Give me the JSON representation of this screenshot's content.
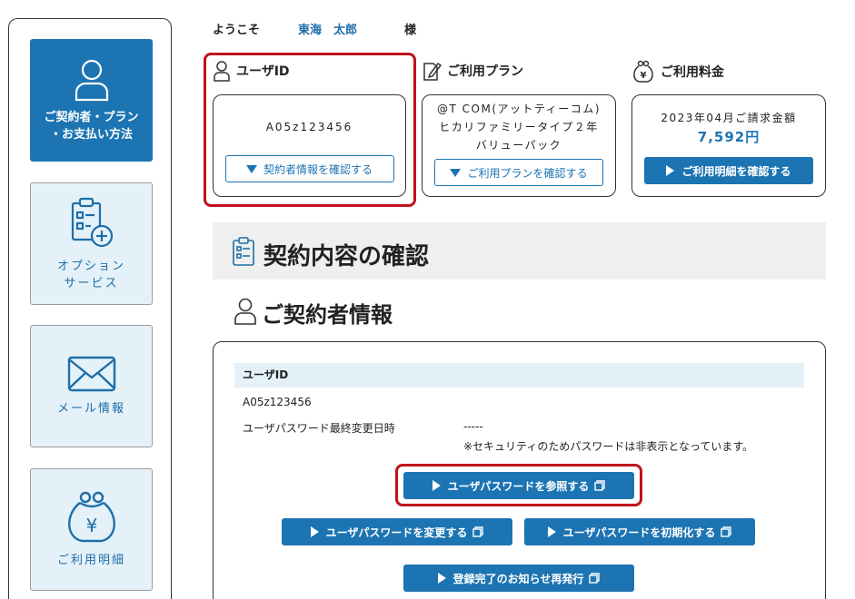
{
  "welcome": {
    "prefix": "ようこそ",
    "name": "東海　太郎",
    "suffix": "様"
  },
  "sidebar": {
    "items": [
      {
        "label": "ご契約者・プラン\n・お支払い方法",
        "icon": "person-icon",
        "active": true
      },
      {
        "label": "オプション\nサービス",
        "icon": "clipboard-plus-icon",
        "active": false
      },
      {
        "label": "メール情報",
        "icon": "envelope-icon",
        "active": false
      },
      {
        "label": "ご利用明細",
        "icon": "yen-purse-icon",
        "active": false
      }
    ]
  },
  "cards": {
    "user_id": {
      "title": "ユーザID",
      "value": "A05z123456",
      "button": "契約者情報を確認する"
    },
    "plan": {
      "title": "ご利用プラン",
      "value": "@T COM(アットティーコム)ヒカリファミリータイプ２年バリューパック",
      "button": "ご利用プランを確認する"
    },
    "fee": {
      "title": "ご利用料金",
      "billing_label": "2023年04月ご請求金額",
      "amount": "7,592円",
      "button": "ご利用明細を確認する"
    }
  },
  "section": {
    "title": "契約内容の確認",
    "subtitle": "ご契約者情報"
  },
  "panel": {
    "bar_label": "ユーザID",
    "user_id_value": "A05z123456",
    "pw_changed_label": "ユーザパスワード最終変更日時",
    "pw_changed_value": "-----",
    "security_note": "※セキュリティのためパスワードは非表示となっています。",
    "buttons": {
      "view_password": "ユーザパスワードを参照する",
      "change_password": "ユーザパスワードを変更する",
      "reset_password": "ユーザパスワードを初期化する",
      "reissue_notice": "登録完了のお知らせ再発行"
    }
  },
  "colors": {
    "primary": "#1c74b2",
    "highlight": "#c0121b",
    "inactive_bg": "#e4f1f8"
  }
}
